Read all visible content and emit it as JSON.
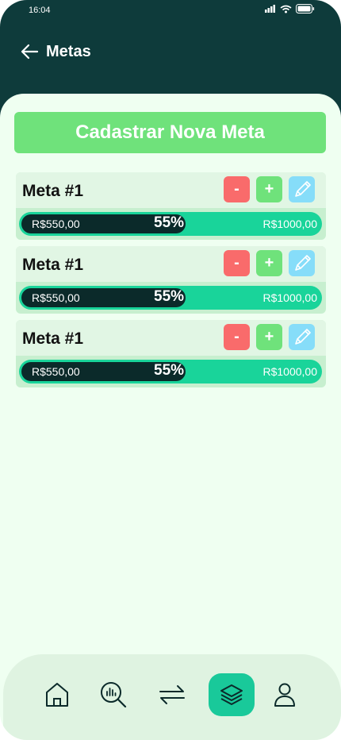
{
  "status_bar": {
    "time": "16:04"
  },
  "header": {
    "title": "Metas",
    "back_icon": "arrow-left-icon"
  },
  "cta": {
    "label": "Cadastrar Nova Meta"
  },
  "goals": [
    {
      "title": "Meta #1",
      "current": "R$550,00",
      "percent_label": "55%",
      "progress": 0.55,
      "target": "R$1000,00",
      "minus": "-",
      "plus": "+"
    },
    {
      "title": "Meta #1",
      "current": "R$550,00",
      "percent_label": "55%",
      "progress": 0.55,
      "target": "R$1000,00",
      "minus": "-",
      "plus": "+"
    },
    {
      "title": "Meta #1",
      "current": "R$550,00",
      "percent_label": "55%",
      "progress": 0.55,
      "target": "R$1000,00",
      "minus": "-",
      "plus": "+"
    }
  ],
  "nav": [
    {
      "icon": "home-icon",
      "active": false
    },
    {
      "icon": "analytics-search-icon",
      "active": false
    },
    {
      "icon": "transfer-arrows-icon",
      "active": false
    },
    {
      "icon": "layers-icon",
      "active": true
    },
    {
      "icon": "user-icon",
      "active": false
    }
  ],
  "colors": {
    "header_bg": "#0e3b3b",
    "accent_green": "#6fe27b",
    "minus_red": "#f96b6b",
    "edit_blue": "#86ddf9",
    "progress_track": "#19d49a",
    "progress_fill": "#0b2a2a"
  }
}
